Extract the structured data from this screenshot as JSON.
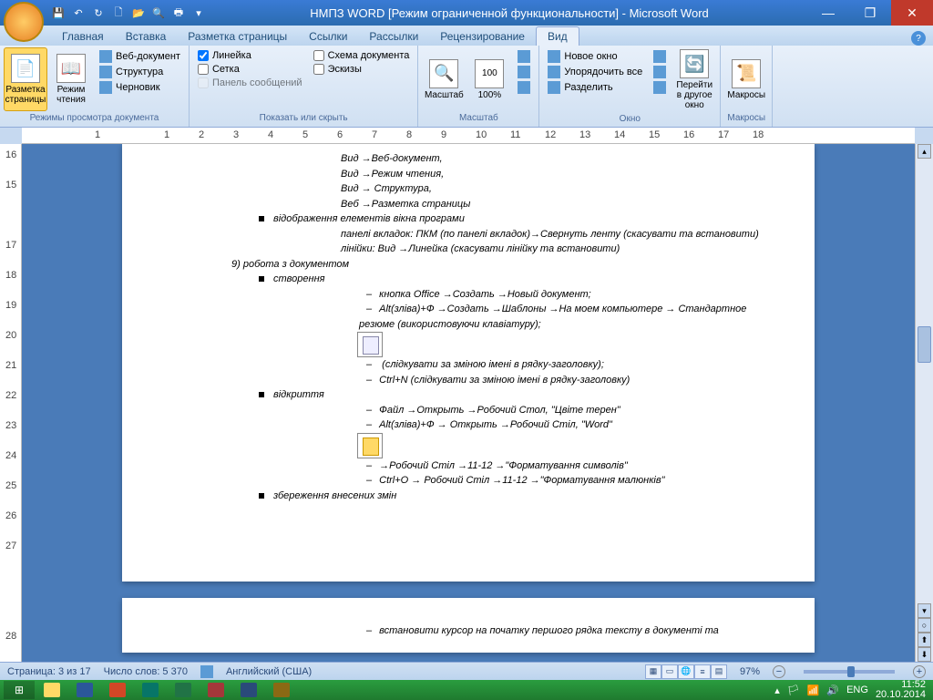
{
  "titlebar": {
    "title": "НМПЗ WORD [Режим ограниченной функциональности] - Microsoft Word"
  },
  "tabs": {
    "home": "Главная",
    "insert": "Вставка",
    "layout": "Разметка страницы",
    "refs": "Ссылки",
    "mail": "Рассылки",
    "review": "Рецензирование",
    "view": "Вид"
  },
  "ribbon": {
    "views": {
      "print_layout": "Разметка страницы",
      "reading": "Режим чтения",
      "web": "Веб-документ",
      "outline": "Структура",
      "draft": "Черновик",
      "group": "Режимы просмотра документа"
    },
    "show": {
      "ruler": "Линейка",
      "gridlines": "Сетка",
      "msgbar": "Панель сообщений",
      "docmap": "Схема документа",
      "thumbs": "Эскизы",
      "group": "Показать или скрыть"
    },
    "zoom": {
      "zoom": "Масштаб",
      "hundred": "100%",
      "group": "Масштаб"
    },
    "window": {
      "new": "Новое окно",
      "arrange": "Упорядочить все",
      "split": "Разделить",
      "switch": "Перейти в другое окно",
      "group": "Окно"
    },
    "macros": {
      "macros": "Макросы",
      "group": "Макросы"
    }
  },
  "doc": {
    "l1": "Вид →Веб-документ,",
    "l2": "Вид →Режим чтения,",
    "l3": "Вид → Структура,",
    "l4": " Веб →Разметка страницы",
    "b1": "відображення елементів вікна програми",
    "l5": "панелі вкладок: ПКМ (по панелі вкладок)→Свернуть ленту (скасувати та встановити)",
    "l6": "лінійки: Вид →Линейка (скасувати лінійку та встановити)",
    "n9": "9)     робота з документом",
    "b2": "створення",
    "l7": "кнопка Office →Создать →Новый документ;",
    "l8": "Alt(зліва)+Ф →Создать →Шаблоны →На моем компьютере →  Стандартное резюме (використовуючи клавіатуру);",
    "l9": " (слідкувати за зміною імені в рядку-заголовку);",
    "l10": "Ctrl+N (слідкувати за зміною імені в рядку-заголовку)",
    "b3": "відкриття",
    "l11": "Файл →Открыть →Робочий Стол, \"Цвіте терен\"",
    "l12": "Alt(зліва)+Ф → Открыть →Робочий Стіл, \"Word\"",
    "l13": "→Робочий Стіл →11-12 →\"Форматування символів\"",
    "l14": "Ctrl+O  → Робочий Стіл →11-12 →\"Форматування малюнків\"",
    "b4": "збереження внесених змін",
    "p2": "встановити курсор на початку першого рядка тексту в документі та"
  },
  "ruler": [
    "1",
    "",
    "1",
    "2",
    "3",
    "4",
    "5",
    "6",
    "7",
    "8",
    "9",
    "10",
    "11",
    "12",
    "13",
    "14",
    "15",
    "16",
    "17",
    "18"
  ],
  "vruler": [
    "16",
    "15",
    "",
    "17",
    "18",
    "19",
    "20",
    "21",
    "22",
    "23",
    "24",
    "25",
    "26",
    "27",
    "",
    "",
    "28"
  ],
  "status": {
    "page": "Страница: 3 из 17",
    "words": "Число слов: 5 370",
    "lang": "Английский (США)",
    "zoom": "97%"
  },
  "tray": {
    "lang": "ENG",
    "time": "11:52",
    "date": "20.10.2014"
  }
}
